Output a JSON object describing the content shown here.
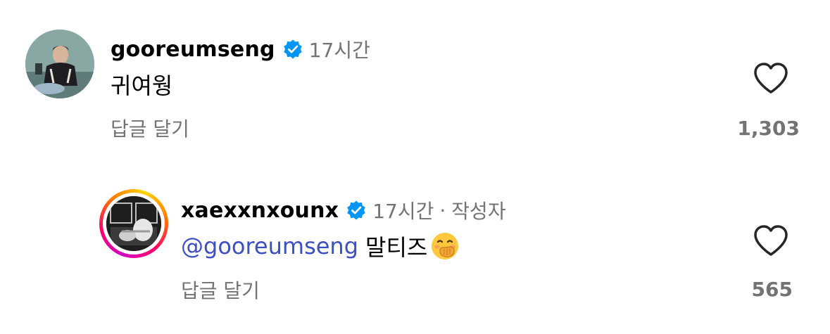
{
  "comments": [
    {
      "username": "gooreumseng",
      "verified_icon": "verified-badge-icon",
      "time": "17시간",
      "text": "귀여웡",
      "reply_label": "답글 달기",
      "like_count": "1,303"
    },
    {
      "username": "xaexxnxounx",
      "verified_icon": "verified-badge-icon",
      "time": "17시간",
      "separator": "·",
      "author_tag": "작성자",
      "mention": "@gooreumseng",
      "text": "말티즈",
      "emoji_icon": "hand-over-mouth-emoji",
      "reply_label": "답글 달기",
      "like_count": "565"
    }
  ],
  "colors": {
    "verified": "#0095f6",
    "secondary_text": "#737373",
    "mention": "#3c4fc6"
  }
}
